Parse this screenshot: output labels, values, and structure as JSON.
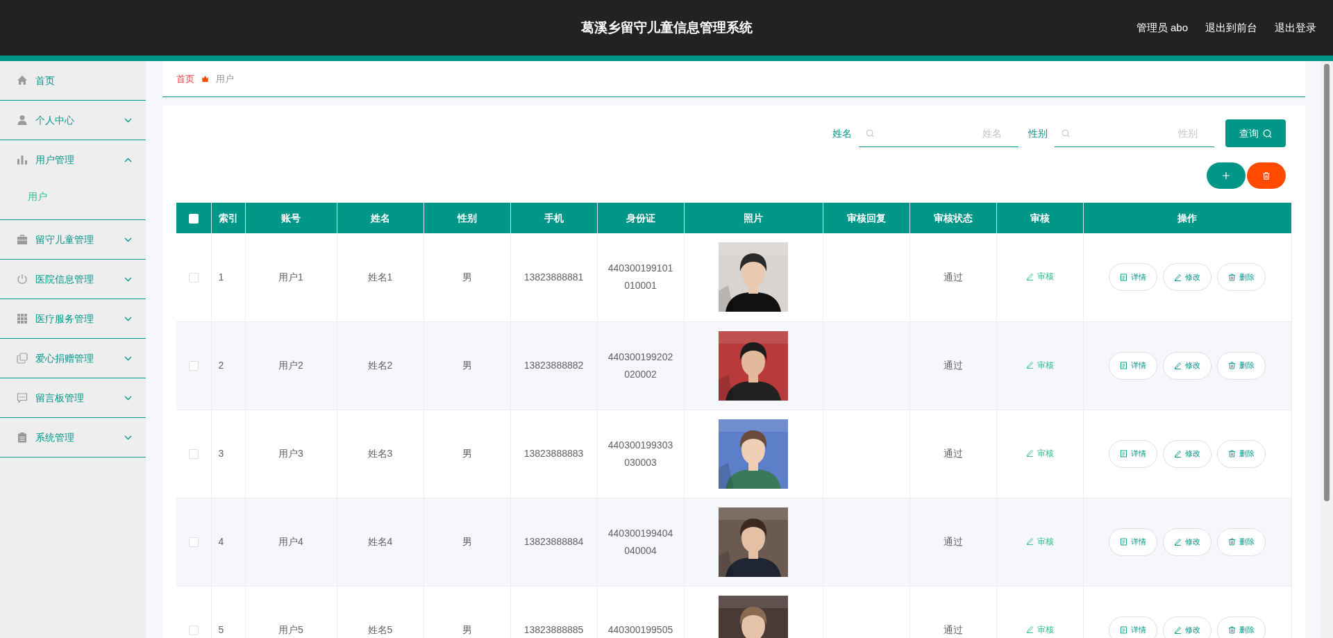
{
  "header": {
    "title": "葛溪乡留守儿童信息管理系统",
    "links": [
      "管理员 abo",
      "退出到前台",
      "退出登录"
    ]
  },
  "sidebar": {
    "items": [
      {
        "label": "首页"
      },
      {
        "label": "个人中心",
        "expanded": false
      },
      {
        "label": "用户管理",
        "expanded": true,
        "children": [
          {
            "label": "用户",
            "selected": true
          }
        ]
      },
      {
        "label": "留守儿童管理",
        "expanded": false
      },
      {
        "label": "医院信息管理",
        "expanded": false
      },
      {
        "label": "医疗服务管理",
        "expanded": false
      },
      {
        "label": "爱心捐赠管理",
        "expanded": false
      },
      {
        "label": "留言板管理",
        "expanded": false
      },
      {
        "label": "系统管理",
        "expanded": false
      }
    ]
  },
  "breadcrumb": [
    "首页",
    "用户"
  ],
  "search": {
    "fields": [
      {
        "label": "姓名",
        "placeholder": "姓名"
      },
      {
        "label": "性别",
        "placeholder": "性别"
      }
    ],
    "button": "查询"
  },
  "table": {
    "select_all": {
      "checked": false
    },
    "columns": [
      "索引",
      "账号",
      "姓名",
      "性别",
      "手机",
      "身份证",
      "照片",
      "审核回复",
      "审核状态",
      "审核",
      "操作"
    ],
    "rows": [
      {
        "checked": false,
        "index": "1",
        "account": "用户1",
        "name": "姓名1",
        "gender": "男",
        "phone": "13823888881",
        "id_card": [
          "440300199101",
          "010001"
        ],
        "status": "通过",
        "review": "审核",
        "actions": [
          "详情",
          "修改",
          "删除"
        ]
      },
      {
        "checked": false,
        "index": "2",
        "account": "用户2",
        "name": "姓名2",
        "gender": "男",
        "phone": "13823888882",
        "id_card": [
          "440300199202",
          "020002"
        ],
        "status": "通过",
        "review": "审核",
        "actions": [
          "详情",
          "修改",
          "删除"
        ]
      },
      {
        "checked": false,
        "index": "3",
        "account": "用户3",
        "name": "姓名3",
        "gender": "男",
        "phone": "13823888883",
        "id_card": [
          "440300199303",
          "030003"
        ],
        "status": "通过",
        "review": "审核",
        "actions": [
          "详情",
          "修改",
          "删除"
        ]
      },
      {
        "checked": false,
        "index": "4",
        "account": "用户4",
        "name": "姓名4",
        "gender": "男",
        "phone": "13823888884",
        "id_card": [
          "440300199404",
          "040004"
        ],
        "status": "通过",
        "review": "审核",
        "actions": [
          "详情",
          "修改",
          "删除"
        ]
      },
      {
        "checked": false,
        "index": "5",
        "account": "用户5",
        "name": "姓名5",
        "gender": "男",
        "phone": "13823888885",
        "id_card": [
          "440300199505"
        ],
        "status": "通过",
        "review": "审核",
        "actions": [
          "详情",
          "修改",
          "删除"
        ]
      }
    ]
  }
}
